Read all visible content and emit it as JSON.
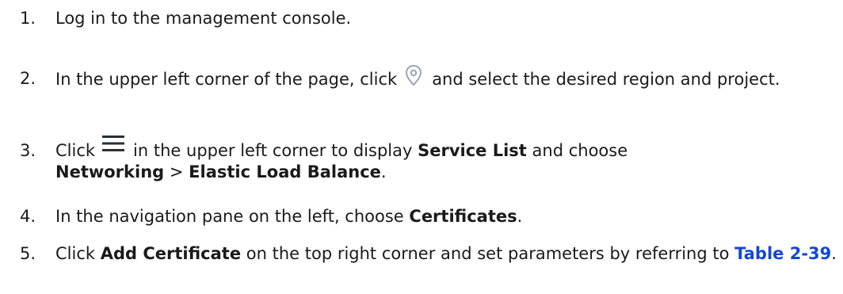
{
  "steps": [
    {
      "number": "1.",
      "text": "Log in to the management console."
    },
    {
      "number": "2.",
      "text_before": "In the upper left corner of the page, click",
      "icon": "location-pin-icon",
      "text_after": "and select the desired region and project."
    },
    {
      "number": "3.",
      "text_before": "Click",
      "icon": "menu-icon",
      "text_mid": "in the upper left corner to display",
      "bold_1": "Service List",
      "text_mid2": "and choose",
      "bold_2": "Networking",
      "separator": ">",
      "bold_3": "Elastic Load Balance",
      "text_end": "."
    },
    {
      "number": "4.",
      "text_before": "In the navigation pane on the left, choose",
      "bold_1": "Certificates",
      "text_end": "."
    },
    {
      "number": "5.",
      "text_before": "Click",
      "bold_1": "Add Certificate",
      "text_mid": "on the top right corner and set parameters by referring to",
      "link": "Table 2-39",
      "text_end": "."
    }
  ],
  "colors": {
    "text": "#1a1a1a",
    "link": "#1447d6",
    "icon": "#9aa7b8",
    "menu_icon": "#2b2f36"
  }
}
